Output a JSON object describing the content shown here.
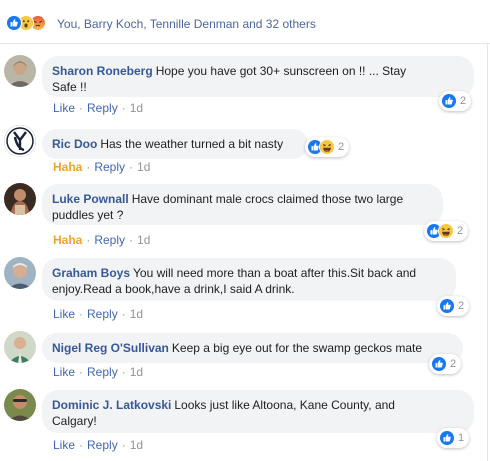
{
  "reactions_summary": {
    "text": "You, Barry Koch, Tennille Denman and 32 others",
    "icons": [
      "like-icon",
      "wow-icon",
      "angry-icon"
    ]
  },
  "colors": {
    "link_blue": "#365899",
    "action_blue": "#4267b2",
    "haha_orange": "#f0a32b",
    "bubble_bg": "#f2f3f5",
    "meta_gray": "#90949c",
    "like_blue": "#1877f2"
  },
  "comments": [
    {
      "author": "Sharon Roneberg",
      "text_line1": "Hope you have got 30+ sunscreen on !! ... Stay",
      "text_line2": "Safe !!",
      "action1": "Like",
      "action2": "Reply",
      "time": "1d",
      "reaction_count": "2",
      "reaction_icons": [
        "like-icon"
      ]
    },
    {
      "author": "Ric Doo",
      "text_line1": "Has the weather turned a bit nasty",
      "action1": "Haha",
      "action2": "Reply",
      "time": "1d",
      "reaction_count": "2",
      "reaction_icons": [
        "like-icon",
        "haha-icon"
      ]
    },
    {
      "author": "Luke Pownall",
      "text_line1": "Have dominant male crocs claimed those two large",
      "text_line2": "puddles yet ?",
      "action1": "Haha",
      "action2": "Reply",
      "time": "1d",
      "reaction_count": "2",
      "reaction_icons": [
        "like-icon",
        "haha-icon"
      ]
    },
    {
      "author": "Graham Boys",
      "text_line1": "You will need more than a boat after this.Sit back and",
      "text_line2": "enjoy.Read a book,have a drink,I said A drink.",
      "action1": "Like",
      "action2": "Reply",
      "time": "1d",
      "reaction_count": "2",
      "reaction_icons": [
        "like-icon"
      ]
    },
    {
      "author": "Nigel Reg O'Sullivan",
      "text_line1": "Keep a big eye out for the swamp geckos mate",
      "action1": "Like",
      "action2": "Reply",
      "time": "1d",
      "reaction_count": "2",
      "reaction_icons": [
        "like-icon"
      ]
    },
    {
      "author": "Dominic J. Latkovski",
      "text_line1": "Looks just like Altoona, Kane County, and",
      "text_line2": "Calgary!",
      "action1": "Like",
      "action2": "Reply",
      "time": "1d",
      "reaction_count": "1",
      "reaction_icons": [
        "like-icon"
      ]
    }
  ]
}
